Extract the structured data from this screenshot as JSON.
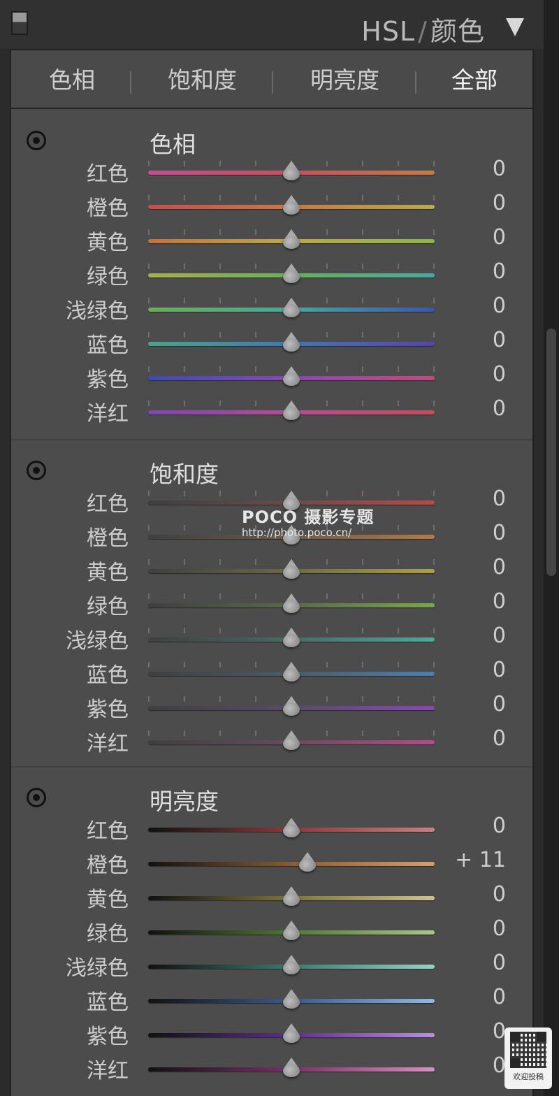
{
  "header": {
    "title_left": "HSL",
    "title_sep": "/",
    "title_right": "颜色"
  },
  "tabs": [
    "色相",
    "饱和度",
    "明亮度",
    "全部"
  ],
  "active_tab": 3,
  "sections": [
    {
      "title": "色相",
      "rows": [
        {
          "label": "红色",
          "value": "0",
          "position": 0.5,
          "gradient": [
            "#c0508e",
            "#c9505f",
            "#c57a4a"
          ]
        },
        {
          "label": "橙色",
          "value": "0",
          "position": 0.5,
          "gradient": [
            "#c44e4e",
            "#c77a45",
            "#b7aa4d"
          ]
        },
        {
          "label": "黄色",
          "value": "0",
          "position": 0.5,
          "gradient": [
            "#c0733f",
            "#bba74d",
            "#8eb34a"
          ]
        },
        {
          "label": "绿色",
          "value": "0",
          "position": 0.5,
          "gradient": [
            "#a6ae4a",
            "#68b05a",
            "#4aa8a0"
          ]
        },
        {
          "label": "浅绿色",
          "value": "0",
          "position": 0.5,
          "gradient": [
            "#6aad55",
            "#46a89d",
            "#3b55b0"
          ]
        },
        {
          "label": "蓝色",
          "value": "0",
          "position": 0.5,
          "gradient": [
            "#47a48a",
            "#3f78b3",
            "#5743b0"
          ]
        },
        {
          "label": "紫色",
          "value": "0",
          "position": 0.5,
          "gradient": [
            "#3f4bb3",
            "#8848b0",
            "#c24a80"
          ]
        },
        {
          "label": "洋红",
          "value": "0",
          "position": 0.5,
          "gradient": [
            "#7f45b4",
            "#b84b93",
            "#c54d5a"
          ]
        }
      ]
    },
    {
      "title": "饱和度",
      "rows": [
        {
          "label": "红色",
          "value": "0",
          "position": 0.5,
          "gradient": [
            "#3f3f3f",
            "#6d4a4a",
            "#b84a4a"
          ]
        },
        {
          "label": "橙色",
          "value": "0",
          "position": 0.5,
          "gradient": [
            "#3f3f3f",
            "#6d5a48",
            "#b37a45"
          ]
        },
        {
          "label": "黄色",
          "value": "0",
          "position": 0.5,
          "gradient": [
            "#3f3f3f",
            "#6c6848",
            "#ada04a"
          ]
        },
        {
          "label": "绿色",
          "value": "0",
          "position": 0.5,
          "gradient": [
            "#3f3f3f",
            "#586a48",
            "#7aa84a"
          ]
        },
        {
          "label": "浅绿色",
          "value": "0",
          "position": 0.5,
          "gradient": [
            "#3f3f3f",
            "#4a6a66",
            "#4ea898"
          ]
        },
        {
          "label": "蓝色",
          "value": "0",
          "position": 0.5,
          "gradient": [
            "#3f3f3f",
            "#4a5a6c",
            "#4a80b0"
          ]
        },
        {
          "label": "紫色",
          "value": "0",
          "position": 0.5,
          "gradient": [
            "#3f3f3f",
            "#5a4a6c",
            "#8a48b2"
          ]
        },
        {
          "label": "洋红",
          "value": "0",
          "position": 0.5,
          "gradient": [
            "#3f3f3f",
            "#6a4a60",
            "#b64a8c"
          ]
        }
      ]
    },
    {
      "title": "明亮度",
      "rows": [
        {
          "label": "红色",
          "value": "0",
          "position": 0.5,
          "gradient": [
            "#111111",
            "#8a3a3a",
            "#c98080"
          ]
        },
        {
          "label": "橙色",
          "value": "+ 11",
          "position": 0.555,
          "gradient": [
            "#111111",
            "#8a5a30",
            "#d0a070"
          ]
        },
        {
          "label": "黄色",
          "value": "0",
          "position": 0.5,
          "gradient": [
            "#111111",
            "#7f7538",
            "#cfc090"
          ]
        },
        {
          "label": "绿色",
          "value": "0",
          "position": 0.5,
          "gradient": [
            "#111111",
            "#4e7a30",
            "#a8c888"
          ]
        },
        {
          "label": "浅绿色",
          "value": "0",
          "position": 0.5,
          "gradient": [
            "#111111",
            "#3a7a70",
            "#98d0c8"
          ]
        },
        {
          "label": "蓝色",
          "value": "0",
          "position": 0.5,
          "gradient": [
            "#111111",
            "#3a5a8a",
            "#90b8e0"
          ]
        },
        {
          "label": "紫色",
          "value": "0",
          "position": 0.5,
          "gradient": [
            "#111111",
            "#5a308a",
            "#b890e0"
          ]
        },
        {
          "label": "洋红",
          "value": "0",
          "position": 0.5,
          "gradient": [
            "#111111",
            "#7a3068",
            "#d890c0"
          ]
        }
      ]
    }
  ],
  "watermark": {
    "main": "POCO 摄影专题",
    "url": "http://photo.poco.cn/"
  },
  "qr_badge": {
    "caption": "欢迎投稿"
  }
}
